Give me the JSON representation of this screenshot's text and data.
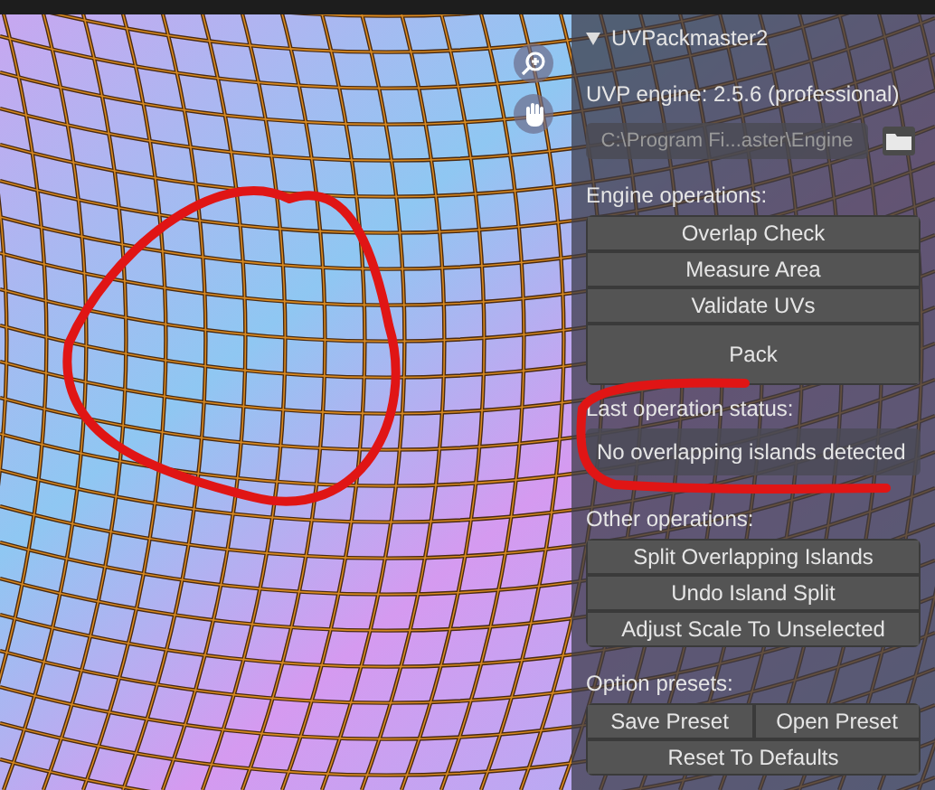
{
  "panel": {
    "title": "UVPackmaster2",
    "engine_info": "UVP engine: 2.5.6 (professional)",
    "engine_path": "C:\\Program Fi...aster\\Engine",
    "engine_operations": {
      "label": "Engine operations:",
      "buttons": [
        "Overlap Check",
        "Measure Area",
        "Validate UVs"
      ],
      "main_button": "Pack"
    },
    "status": {
      "label": "Last operation status:",
      "message": "No overlapping islands detected"
    },
    "other_operations": {
      "label": "Other operations:",
      "buttons": [
        "Split Overlapping Islands",
        "Undo Island Split",
        "Adjust Scale To Unselected"
      ]
    },
    "option_presets": {
      "label": "Option presets:",
      "row": [
        "Save Preset",
        "Open Preset"
      ],
      "buttons": [
        "Reset To Defaults"
      ]
    }
  }
}
